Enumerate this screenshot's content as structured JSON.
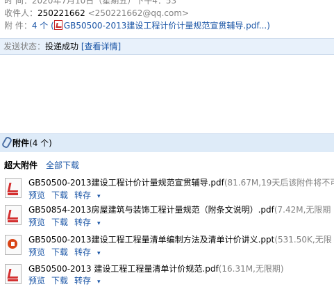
{
  "header": {
    "time_label": "时    间：",
    "time_value": "2020年7月10日（星期五）下午4：53",
    "to_label": "收件人：",
    "to_name": "250221662",
    "to_email": "<250221662@qq.com>",
    "attach_label": "附    件：",
    "attach_count": "4 个 (",
    "attach_preview": "GB50500-2013建设工程计价计量规范宣贯辅导.pdf...",
    "attach_close": ")"
  },
  "status": {
    "label": "发送状态：",
    "value": "投递成功",
    "link": "[查看详情]"
  },
  "attachments": {
    "title": "附件",
    "count": "(4 个)",
    "super_title": "超大附件",
    "download_all": "全部下载",
    "actions": {
      "preview": "预览",
      "download": "下载",
      "forward": "转存"
    },
    "caret": "▾",
    "files": [
      {
        "name": "GB50500-2013建设工程计价计量规范宣贯辅导.pdf",
        "meta": "(81.67M,19天后该附件将不可",
        "icon": "pdf-file-icon"
      },
      {
        "name": "GB50854-2013房屋建筑与装饰工程计量规范（附条文说明）.pdf",
        "meta": "(7.42M,无限期",
        "icon": "pdf-file-icon"
      },
      {
        "name": "GB50500-2013建设工程工程量清单编制方法及清单计价讲义.ppt",
        "meta": "(531.50K,无限",
        "icon": "ppt-file-icon"
      },
      {
        "name": "GB50500-2013 建设工程工程量清单计价规范.pdf",
        "meta": "(16.31M,无限期)",
        "icon": "pdf-file-icon"
      }
    ]
  }
}
